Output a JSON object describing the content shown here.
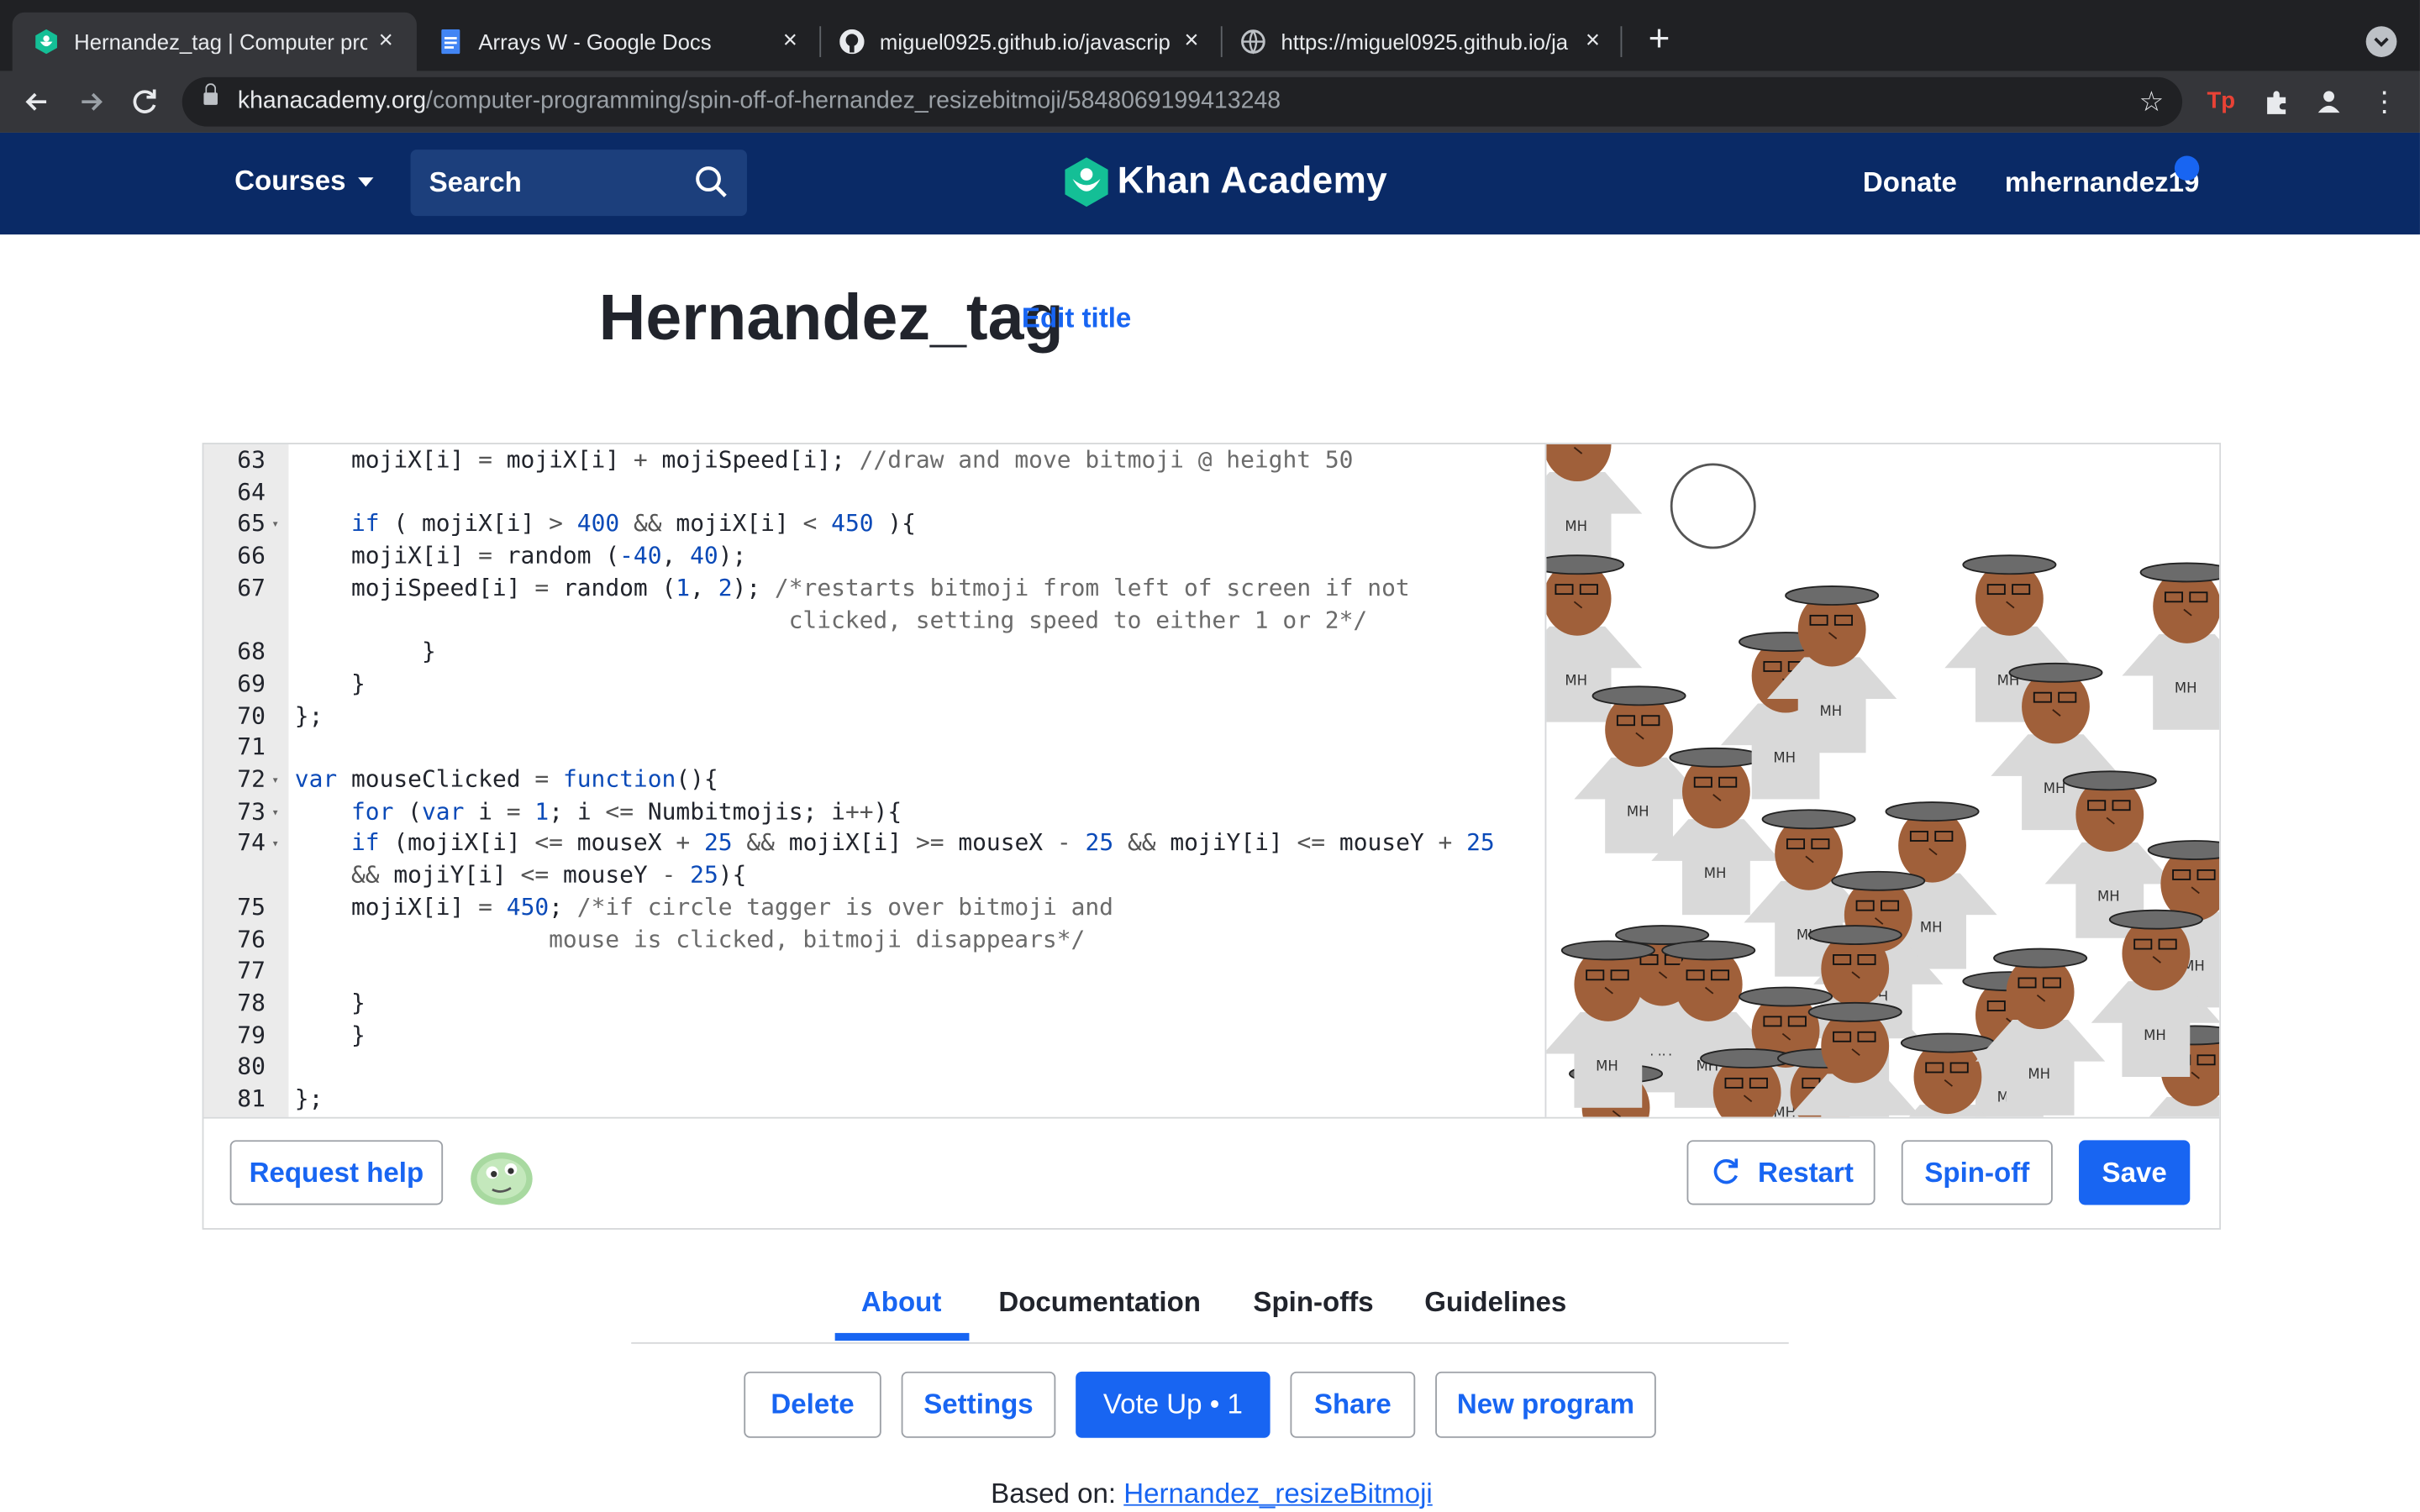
{
  "browser": {
    "tabs": [
      {
        "title": "Hernandez_tag | Computer pro",
        "icon": "khan-academy-favicon",
        "active": true
      },
      {
        "title": "Arrays W - Google Docs",
        "icon": "google-docs-icon",
        "active": false
      },
      {
        "title": "miguel0925.github.io/javascrip",
        "icon": "github-icon",
        "active": false
      },
      {
        "title": "https://miguel0925.github.io/ja",
        "icon": "globe-icon",
        "active": false
      }
    ],
    "new_tab": "+",
    "close_glyph": "×",
    "url_host": "khanacademy.org",
    "url_path": "/computer-programming/spin-off-of-hernandez_resizebitmoji/5848069199413248",
    "ext_tp": "Tp"
  },
  "ka": {
    "courses": "Courses",
    "search": "Search",
    "logo": "Khan Academy",
    "donate": "Donate",
    "username": "mhernandez19",
    "brand_color": "#0a2a66",
    "accent": "#1865f2"
  },
  "program": {
    "title": "Hernandez_tag",
    "edit_title": "Edit title"
  },
  "code_lines": [
    {
      "n": "63",
      "html": "    mojiX[i] <span class='op'>=</span> mojiX[i] <span class='op'>+</span> mojiSpeed[i]; <span class='cm'>//draw and move bitmoji @ height 50</span>"
    },
    {
      "n": "64",
      "html": ""
    },
    {
      "n": "65",
      "fold": true,
      "html": "    <span class='kw'>if</span> ( mojiX[i] <span class='op'>&gt;</span> <span class='num'>400</span> <span class='op'>&amp;&amp;</span> mojiX[i] <span class='op'>&lt;</span> <span class='num'>450</span> ){"
    },
    {
      "n": "66",
      "html": "    mojiX[i] <span class='op'>=</span> random (<span class='num'>-40</span>, <span class='num'>40</span>);"
    },
    {
      "n": "67",
      "html": "    mojiSpeed[i] <span class='op'>=</span> random (<span class='num'>1</span>, <span class='num'>2</span>); <span class='cm'>/*restarts bitmoji from left of screen if not</span>"
    },
    {
      "n": "",
      "html": "<span class='cm'>                                   clicked, setting speed to either 1 or 2*/</span>"
    },
    {
      "n": "68",
      "html": "         }"
    },
    {
      "n": "69",
      "html": "    }"
    },
    {
      "n": "70",
      "html": "};"
    },
    {
      "n": "71",
      "html": ""
    },
    {
      "n": "72",
      "fold": true,
      "html": "<span class='kw'>var</span> mouseClicked <span class='op'>=</span> <span class='kw'>function</span>(){"
    },
    {
      "n": "73",
      "fold": true,
      "html": "    <span class='kw'>for</span> (<span class='kw'>var</span> i <span class='op'>=</span> <span class='num'>1</span>; i <span class='op'>&lt;=</span> Numbitmojis; i<span class='op'>++</span>){"
    },
    {
      "n": "74",
      "fold": true,
      "html": "    <span class='kw'>if</span> (mojiX[i] <span class='op'>&lt;=</span> mouseX <span class='op'>+</span> <span class='num'>25</span> <span class='op'>&amp;&amp;</span> mojiX[i] <span class='op'>&gt;=</span> mouseX <span class='op'>-</span> <span class='num'>25</span> <span class='op'>&amp;&amp;</span> mojiY[i] <span class='op'>&lt;=</span> mouseY <span class='op'>+</span> <span class='num'>25</span>"
    },
    {
      "n": "",
      "html": "    <span class='op'>&amp;&amp;</span> mojiY[i] <span class='op'>&lt;=</span> mouseY <span class='op'>-</span> <span class='num'>25</span>){"
    },
    {
      "n": "75",
      "html": "    mojiX[i] <span class='op'>=</span> <span class='num'>450</span>; <span class='cm'>/*if circle tagger is over bitmoji and</span>"
    },
    {
      "n": "76",
      "html": "<span class='cm'>                  mouse is clicked, bitmoji disappears*/</span>"
    },
    {
      "n": "77",
      "html": ""
    },
    {
      "n": "78",
      "html": "    }"
    },
    {
      "n": "79",
      "html": "    }"
    },
    {
      "n": "80",
      "html": ""
    },
    {
      "n": "81",
      "html": "};"
    }
  ],
  "canvas": {
    "badge_text": "MH"
  },
  "editor_buttons": {
    "request_help": "Request help",
    "restart": "Restart",
    "spinoff": "Spin-off",
    "save": "Save"
  },
  "page_tabs": [
    "About",
    "Documentation",
    "Spin-offs",
    "Guidelines"
  ],
  "actions": {
    "delete": "Delete",
    "settings": "Settings",
    "vote_up": "Vote Up • 1",
    "share": "Share",
    "new_program": "New program"
  },
  "based_on": {
    "label": "Based on:",
    "link": "Hernandez_resizeBitmoji"
  }
}
